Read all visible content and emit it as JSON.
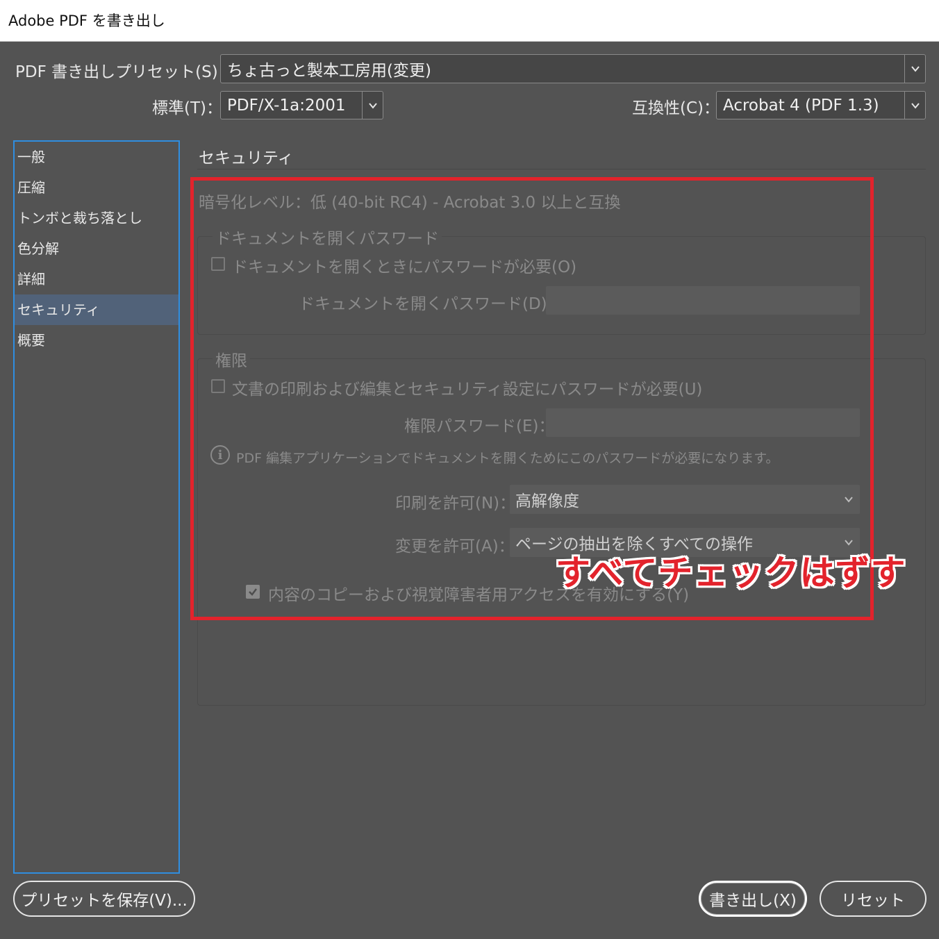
{
  "window": {
    "title": "Adobe PDF を書き出し"
  },
  "header": {
    "preset_label": "PDF 書き出しプリセット(S)：",
    "preset_value": "ちょ古っと製本工房用(変更)",
    "standard_label": "標準(T)：",
    "standard_value": "PDF/X-1a:2001",
    "compat_label": "互換性(C)：",
    "compat_value": "Acrobat 4 (PDF 1.3)"
  },
  "sidebar": {
    "items": [
      {
        "label": "一般",
        "active": false
      },
      {
        "label": "圧縮",
        "active": false
      },
      {
        "label": "トンボと裁ち落とし",
        "active": false
      },
      {
        "label": "色分解",
        "active": false
      },
      {
        "label": "詳細",
        "active": false
      },
      {
        "label": "セキュリティ",
        "active": true
      },
      {
        "label": "概要",
        "active": false
      }
    ]
  },
  "security": {
    "title": "セキュリティ",
    "encryption_level": "暗号化レベル：低 (40-bit RC4) - Acrobat 3.0 以上と互換",
    "open_password_group": {
      "legend": "ドキュメントを開くパスワード",
      "require_label": "ドキュメントを開くときにパスワードが必要(O)",
      "require_checked": false,
      "password_label": "ドキュメントを開くパスワード(D)：",
      "password_value": ""
    },
    "permissions_group": {
      "legend": "権限",
      "require_label": "文書の印刷および編集とセキュリティ設定にパスワードが必要(U)",
      "require_checked": false,
      "password_label": "権限パスワード(E)：",
      "password_value": "",
      "info_text": "PDF 編集アプリケーションでドキュメントを開くためにこのパスワードが必要になります。",
      "print_label": "印刷を許可(N)：",
      "print_value": "高解像度",
      "change_label": "変更を許可(A)：",
      "change_value": "ページの抽出を除くすべての操作",
      "copy_label": "内容のコピーおよび視覚障害者用アクセスを有効にする(Y)",
      "copy_checked": true
    }
  },
  "annotation": {
    "text": "すべてチェックはずす",
    "color": "#e3232c"
  },
  "footer": {
    "save_preset_label": "プリセットを保存(V)...",
    "export_label": "書き出し(X)",
    "reset_label": "リセット"
  },
  "icons": {
    "dropdown": "chevron-down-icon",
    "info": "info-icon",
    "check": "check-icon"
  }
}
